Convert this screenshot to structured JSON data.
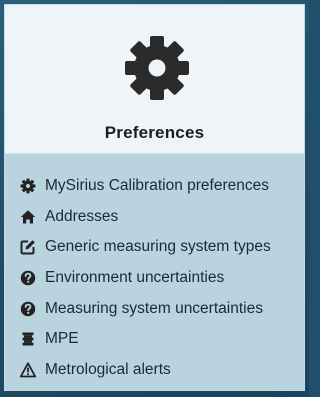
{
  "card": {
    "title": "Preferences",
    "icon": "gear-icon"
  },
  "menu": {
    "items": [
      {
        "label": "MySirius Calibration preferences",
        "icon": "gear-icon"
      },
      {
        "label": "Addresses",
        "icon": "home-icon"
      },
      {
        "label": "Generic measuring system types",
        "icon": "edit-square-icon"
      },
      {
        "label": "Environment uncertainties",
        "icon": "question-circle-icon"
      },
      {
        "label": "Measuring system uncertainties",
        "icon": "question-circle-icon"
      },
      {
        "label": "MPE",
        "icon": "stack-bars-icon"
      },
      {
        "label": "Metrological alerts",
        "icon": "warning-triangle-icon"
      }
    ]
  },
  "colors": {
    "header_bg": "#eef4f7",
    "body_bg": "#b9d3df",
    "icon": "#222222",
    "frame": "#1f4f6a"
  }
}
